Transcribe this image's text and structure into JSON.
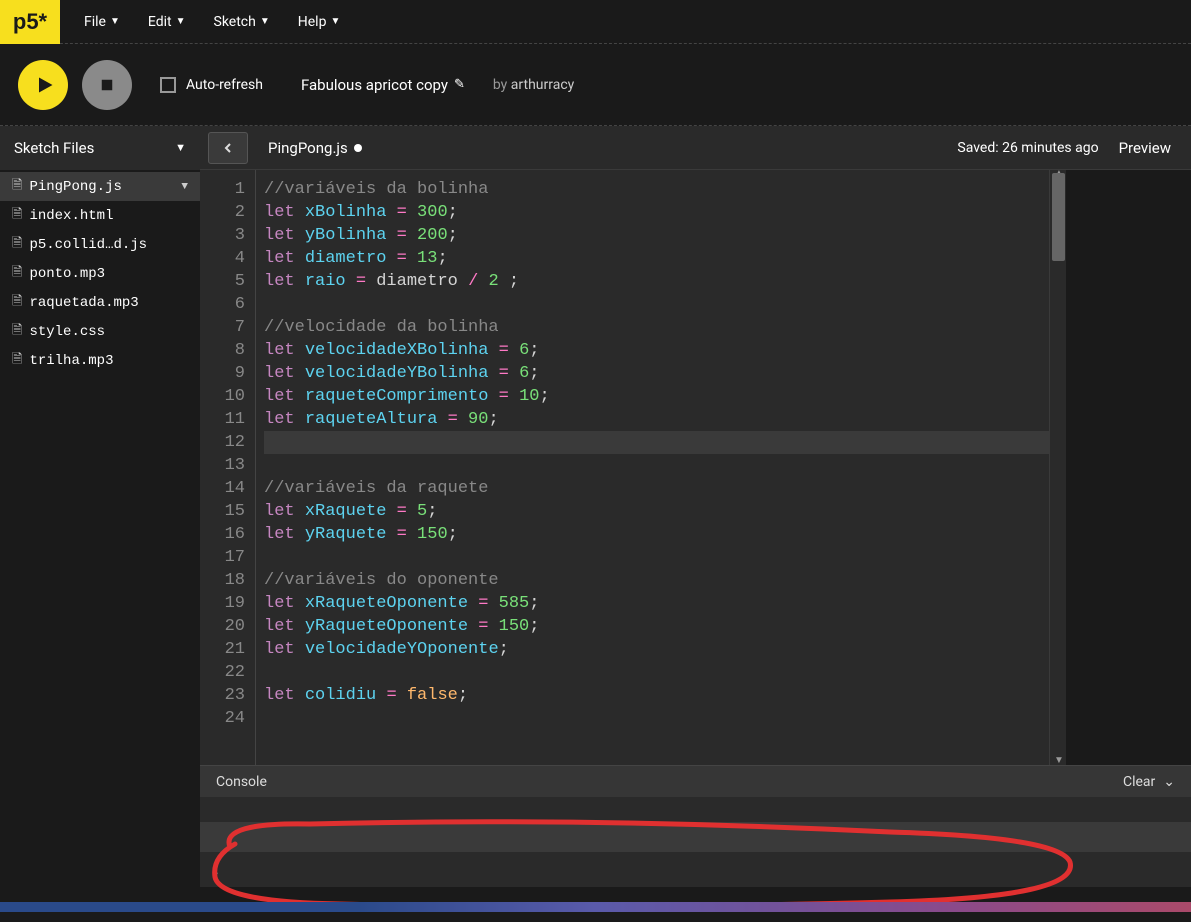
{
  "logo": "p5*",
  "menu": [
    "File",
    "Edit",
    "Sketch",
    "Help"
  ],
  "toolbar": {
    "auto_refresh": "Auto-refresh",
    "sketch_name": "Fabulous apricot copy",
    "by": "by",
    "author": "arthurracy"
  },
  "subbar": {
    "sketch_files": "Sketch Files",
    "open_file": "PingPong.js",
    "saved": "Saved: 26 minutes ago",
    "preview": "Preview"
  },
  "files": [
    {
      "name": "PingPong.js",
      "active": true
    },
    {
      "name": "index.html",
      "active": false
    },
    {
      "name": "p5.collid…d.js",
      "active": false
    },
    {
      "name": "ponto.mp3",
      "active": false
    },
    {
      "name": "raquetada.mp3",
      "active": false
    },
    {
      "name": "style.css",
      "active": false
    },
    {
      "name": "trilha.mp3",
      "active": false
    }
  ],
  "code_lines": [
    {
      "n": 1,
      "tokens": [
        [
          "c-comment",
          "//variáveis da bolinha"
        ]
      ]
    },
    {
      "n": 2,
      "tokens": [
        [
          "c-keyword",
          "let "
        ],
        [
          "c-var",
          "xBolinha"
        ],
        [
          "c-punct",
          " "
        ],
        [
          "c-op",
          "="
        ],
        [
          "c-punct",
          " "
        ],
        [
          "c-num",
          "300"
        ],
        [
          "c-punct",
          ";"
        ]
      ]
    },
    {
      "n": 3,
      "tokens": [
        [
          "c-keyword",
          "let "
        ],
        [
          "c-var",
          "yBolinha"
        ],
        [
          "c-punct",
          " "
        ],
        [
          "c-op",
          "="
        ],
        [
          "c-punct",
          " "
        ],
        [
          "c-num",
          "200"
        ],
        [
          "c-punct",
          ";"
        ]
      ]
    },
    {
      "n": 4,
      "tokens": [
        [
          "c-keyword",
          "let "
        ],
        [
          "c-var",
          "diametro"
        ],
        [
          "c-punct",
          " "
        ],
        [
          "c-op",
          "="
        ],
        [
          "c-punct",
          " "
        ],
        [
          "c-num",
          "13"
        ],
        [
          "c-punct",
          ";"
        ]
      ]
    },
    {
      "n": 5,
      "tokens": [
        [
          "c-keyword",
          "let "
        ],
        [
          "c-var",
          "raio"
        ],
        [
          "c-punct",
          " "
        ],
        [
          "c-op",
          "="
        ],
        [
          "c-punct",
          " diametro "
        ],
        [
          "c-op",
          "/"
        ],
        [
          "c-punct",
          " "
        ],
        [
          "c-num",
          "2"
        ],
        [
          "c-punct",
          " ;"
        ]
      ]
    },
    {
      "n": 6,
      "tokens": []
    },
    {
      "n": 7,
      "tokens": [
        [
          "c-comment",
          "//velocidade da bolinha"
        ]
      ]
    },
    {
      "n": 8,
      "tokens": [
        [
          "c-keyword",
          "let "
        ],
        [
          "c-var",
          "velocidadeXBolinha"
        ],
        [
          "c-punct",
          " "
        ],
        [
          "c-op",
          "="
        ],
        [
          "c-punct",
          " "
        ],
        [
          "c-num",
          "6"
        ],
        [
          "c-punct",
          ";"
        ]
      ]
    },
    {
      "n": 9,
      "tokens": [
        [
          "c-keyword",
          "let "
        ],
        [
          "c-var",
          "velocidadeYBolinha"
        ],
        [
          "c-punct",
          " "
        ],
        [
          "c-op",
          "="
        ],
        [
          "c-punct",
          " "
        ],
        [
          "c-num",
          "6"
        ],
        [
          "c-punct",
          ";"
        ]
      ]
    },
    {
      "n": 10,
      "tokens": [
        [
          "c-keyword",
          "let "
        ],
        [
          "c-var",
          "raqueteComprimento"
        ],
        [
          "c-punct",
          " "
        ],
        [
          "c-op",
          "="
        ],
        [
          "c-punct",
          " "
        ],
        [
          "c-num",
          "10"
        ],
        [
          "c-punct",
          ";"
        ]
      ]
    },
    {
      "n": 11,
      "tokens": [
        [
          "c-keyword",
          "let "
        ],
        [
          "c-var",
          "raqueteAltura"
        ],
        [
          "c-punct",
          " "
        ],
        [
          "c-op",
          "="
        ],
        [
          "c-punct",
          " "
        ],
        [
          "c-num",
          "90"
        ],
        [
          "c-punct",
          ";"
        ]
      ]
    },
    {
      "n": 12,
      "tokens": [],
      "current": true
    },
    {
      "n": 13,
      "tokens": []
    },
    {
      "n": 14,
      "tokens": [
        [
          "c-comment",
          "//variáveis da raquete"
        ]
      ]
    },
    {
      "n": 15,
      "tokens": [
        [
          "c-keyword",
          "let "
        ],
        [
          "c-var",
          "xRaquete"
        ],
        [
          "c-punct",
          " "
        ],
        [
          "c-op",
          "="
        ],
        [
          "c-punct",
          " "
        ],
        [
          "c-num",
          "5"
        ],
        [
          "c-punct",
          ";"
        ]
      ]
    },
    {
      "n": 16,
      "tokens": [
        [
          "c-keyword",
          "let "
        ],
        [
          "c-var",
          "yRaquete"
        ],
        [
          "c-punct",
          " "
        ],
        [
          "c-op",
          "="
        ],
        [
          "c-punct",
          " "
        ],
        [
          "c-num",
          "150"
        ],
        [
          "c-punct",
          ";"
        ]
      ]
    },
    {
      "n": 17,
      "tokens": []
    },
    {
      "n": 18,
      "tokens": [
        [
          "c-comment",
          "//variáveis do oponente"
        ]
      ]
    },
    {
      "n": 19,
      "tokens": [
        [
          "c-keyword",
          "let "
        ],
        [
          "c-var",
          "xRaqueteOponente"
        ],
        [
          "c-punct",
          " "
        ],
        [
          "c-op",
          "="
        ],
        [
          "c-punct",
          " "
        ],
        [
          "c-num",
          "585"
        ],
        [
          "c-punct",
          ";"
        ]
      ]
    },
    {
      "n": 20,
      "tokens": [
        [
          "c-keyword",
          "let "
        ],
        [
          "c-var",
          "yRaqueteOponente"
        ],
        [
          "c-punct",
          " "
        ],
        [
          "c-op",
          "="
        ],
        [
          "c-punct",
          " "
        ],
        [
          "c-num",
          "150"
        ],
        [
          "c-punct",
          ";"
        ]
      ]
    },
    {
      "n": 21,
      "tokens": [
        [
          "c-keyword",
          "let "
        ],
        [
          "c-var",
          "velocidadeYOponente"
        ],
        [
          "c-punct",
          ";"
        ]
      ]
    },
    {
      "n": 22,
      "tokens": []
    },
    {
      "n": 23,
      "tokens": [
        [
          "c-keyword",
          "let "
        ],
        [
          "c-var",
          "colidiu"
        ],
        [
          "c-punct",
          " "
        ],
        [
          "c-op",
          "="
        ],
        [
          "c-punct",
          " "
        ],
        [
          "c-bool",
          "false"
        ],
        [
          "c-punct",
          ";"
        ]
      ]
    },
    {
      "n": 24,
      "tokens": []
    }
  ],
  "console": {
    "title": "Console",
    "clear": "Clear"
  }
}
